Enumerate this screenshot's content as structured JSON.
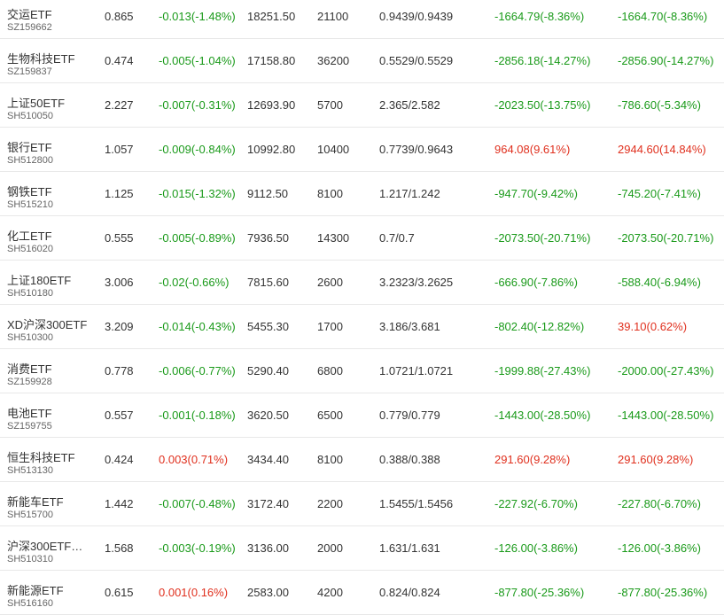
{
  "colors": {
    "up": "#e0301e",
    "down": "#1a9a1a"
  },
  "rows": [
    {
      "name": "交运ETF",
      "code": "SZ159662",
      "price": "0.865",
      "change": "-0.013(-1.48%)",
      "change_dir": "neg",
      "value": "18251.50",
      "qty": "21100",
      "cost": "0.9439/0.9439",
      "pl1": "-1664.79(-8.36%)",
      "pl1_dir": "neg",
      "pl2": "-1664.70(-8.36%)",
      "pl2_dir": "neg"
    },
    {
      "name": "生物科技ETF",
      "code": "SZ159837",
      "price": "0.474",
      "change": "-0.005(-1.04%)",
      "change_dir": "neg",
      "value": "17158.80",
      "qty": "36200",
      "cost": "0.5529/0.5529",
      "pl1": "-2856.18(-14.27%)",
      "pl1_dir": "neg",
      "pl2": "-2856.90(-14.27%)",
      "pl2_dir": "neg"
    },
    {
      "name": "上证50ETF",
      "code": "SH510050",
      "price": "2.227",
      "change": "-0.007(-0.31%)",
      "change_dir": "neg",
      "value": "12693.90",
      "qty": "5700",
      "cost": "2.365/2.582",
      "pl1": "-2023.50(-13.75%)",
      "pl1_dir": "neg",
      "pl2": "-786.60(-5.34%)",
      "pl2_dir": "neg"
    },
    {
      "name": "银行ETF",
      "code": "SH512800",
      "price": "1.057",
      "change": "-0.009(-0.84%)",
      "change_dir": "neg",
      "value": "10992.80",
      "qty": "10400",
      "cost": "0.7739/0.9643",
      "pl1": "964.08(9.61%)",
      "pl1_dir": "pos",
      "pl2": "2944.60(14.84%)",
      "pl2_dir": "pos"
    },
    {
      "name": "钢铁ETF",
      "code": "SH515210",
      "price": "1.125",
      "change": "-0.015(-1.32%)",
      "change_dir": "neg",
      "value": "9112.50",
      "qty": "8100",
      "cost": "1.217/1.242",
      "pl1": "-947.70(-9.42%)",
      "pl1_dir": "neg",
      "pl2": "-745.20(-7.41%)",
      "pl2_dir": "neg"
    },
    {
      "name": "化工ETF",
      "code": "SH516020",
      "price": "0.555",
      "change": "-0.005(-0.89%)",
      "change_dir": "neg",
      "value": "7936.50",
      "qty": "14300",
      "cost": "0.7/0.7",
      "pl1": "-2073.50(-20.71%)",
      "pl1_dir": "neg",
      "pl2": "-2073.50(-20.71%)",
      "pl2_dir": "neg"
    },
    {
      "name": "上证180ETF",
      "code": "SH510180",
      "price": "3.006",
      "change": "-0.02(-0.66%)",
      "change_dir": "neg",
      "value": "7815.60",
      "qty": "2600",
      "cost": "3.2323/3.2625",
      "pl1": "-666.90(-7.86%)",
      "pl1_dir": "neg",
      "pl2": "-588.40(-6.94%)",
      "pl2_dir": "neg"
    },
    {
      "name": "XD沪深300ETF",
      "code": "SH510300",
      "price": "3.209",
      "change": "-0.014(-0.43%)",
      "change_dir": "neg",
      "value": "5455.30",
      "qty": "1700",
      "cost": "3.186/3.681",
      "pl1": "-802.40(-12.82%)",
      "pl1_dir": "neg",
      "pl2": "39.10(0.62%)",
      "pl2_dir": "pos"
    },
    {
      "name": "消费ETF",
      "code": "SZ159928",
      "price": "0.778",
      "change": "-0.006(-0.77%)",
      "change_dir": "neg",
      "value": "5290.40",
      "qty": "6800",
      "cost": "1.0721/1.0721",
      "pl1": "-1999.88(-27.43%)",
      "pl1_dir": "neg",
      "pl2": "-2000.00(-27.43%)",
      "pl2_dir": "neg"
    },
    {
      "name": "电池ETF",
      "code": "SZ159755",
      "price": "0.557",
      "change": "-0.001(-0.18%)",
      "change_dir": "neg",
      "value": "3620.50",
      "qty": "6500",
      "cost": "0.779/0.779",
      "pl1": "-1443.00(-28.50%)",
      "pl1_dir": "neg",
      "pl2": "-1443.00(-28.50%)",
      "pl2_dir": "neg"
    },
    {
      "name": "恒生科技ETF",
      "code": "SH513130",
      "price": "0.424",
      "change": "0.003(0.71%)",
      "change_dir": "pos",
      "value": "3434.40",
      "qty": "8100",
      "cost": "0.388/0.388",
      "pl1": "291.60(9.28%)",
      "pl1_dir": "pos",
      "pl2": "291.60(9.28%)",
      "pl2_dir": "pos"
    },
    {
      "name": "新能车ETF",
      "code": "SH515700",
      "price": "1.442",
      "change": "-0.007(-0.48%)",
      "change_dir": "neg",
      "value": "3172.40",
      "qty": "2200",
      "cost": "1.5455/1.5456",
      "pl1": "-227.92(-6.70%)",
      "pl1_dir": "neg",
      "pl2": "-227.80(-6.70%)",
      "pl2_dir": "neg"
    },
    {
      "name": "沪深300ETF…",
      "code": "SH510310",
      "price": "1.568",
      "change": "-0.003(-0.19%)",
      "change_dir": "neg",
      "value": "3136.00",
      "qty": "2000",
      "cost": "1.631/1.631",
      "pl1": "-126.00(-3.86%)",
      "pl1_dir": "neg",
      "pl2": "-126.00(-3.86%)",
      "pl2_dir": "neg"
    },
    {
      "name": "新能源ETF",
      "code": "SH516160",
      "price": "0.615",
      "change": "0.001(0.16%)",
      "change_dir": "pos",
      "value": "2583.00",
      "qty": "4200",
      "cost": "0.824/0.824",
      "pl1": "-877.80(-25.36%)",
      "pl1_dir": "neg",
      "pl2": "-877.80(-25.36%)",
      "pl2_dir": "neg"
    }
  ]
}
